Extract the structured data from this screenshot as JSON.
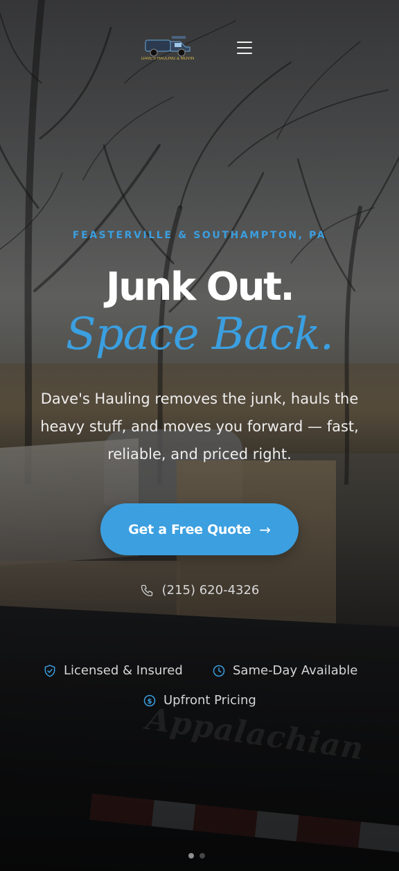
{
  "header": {
    "logo_text": "DAVE'S HAULING & MOVING",
    "menu_icon": "hamburger-menu-icon"
  },
  "hero": {
    "eyebrow": "FEASTERVILLE & SOUTHAMPTON, PA",
    "headline": "Junk Out.",
    "subhead": "Space Back.",
    "lead": "Dave's Hauling removes the junk, hauls the heavy stuff, and moves you forward — fast, reliable, and priced right.",
    "cta_label": "Get a Free Quote",
    "cta_icon": "arrow-right-icon",
    "phone": "(215) 620-4326",
    "phone_icon": "phone-icon"
  },
  "badges": [
    {
      "label": "Licensed & Insured",
      "icon": "shield-check-icon"
    },
    {
      "label": "Same-Day Available",
      "icon": "clock-icon"
    },
    {
      "label": "Upfront Pricing",
      "icon": "dollar-circle-icon"
    }
  ],
  "colors": {
    "accent": "#3b9fe0",
    "text": "#ffffff",
    "muted": "#d6d6d6"
  }
}
